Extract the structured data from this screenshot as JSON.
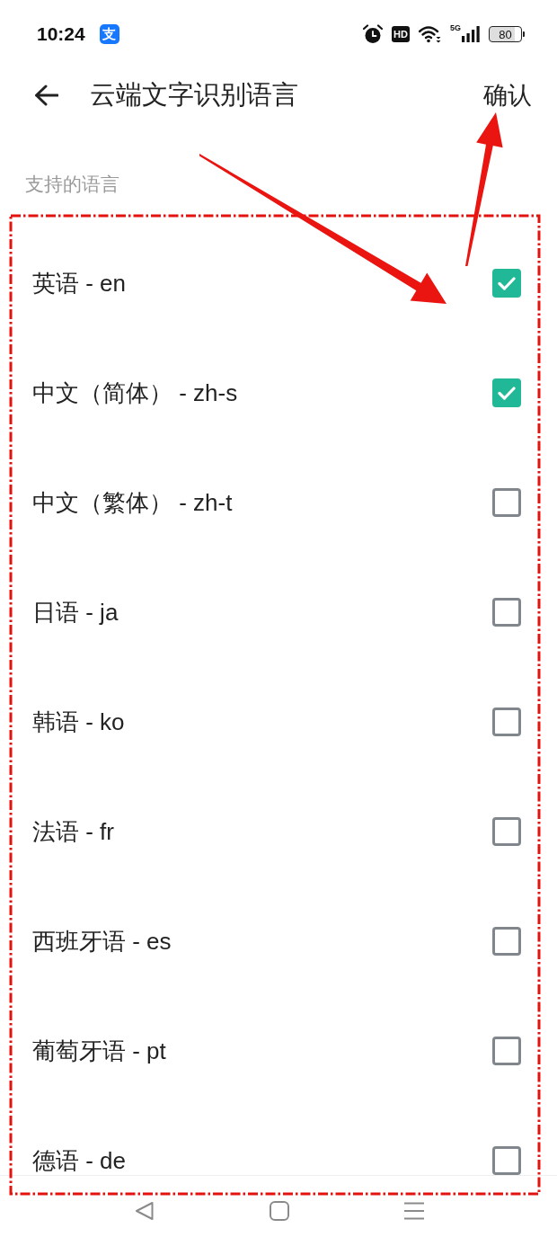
{
  "status_bar": {
    "time": "10:24",
    "app_icon_text": "支",
    "hd_badge": "HD",
    "network_type": "5G",
    "battery": "80"
  },
  "header": {
    "title": "云端文字识别语言",
    "confirm_button": "确认"
  },
  "section_label": "支持的语言",
  "languages": [
    {
      "label": "英语 - en",
      "checked": true
    },
    {
      "label": "中文（简体） - zh-s",
      "checked": true
    },
    {
      "label": "中文（繁体） - zh-t",
      "checked": false
    },
    {
      "label": "日语 - ja",
      "checked": false
    },
    {
      "label": "韩语 - ko",
      "checked": false
    },
    {
      "label": "法语 - fr",
      "checked": false
    },
    {
      "label": "西班牙语 - es",
      "checked": false
    },
    {
      "label": "葡萄牙语 - pt",
      "checked": false
    },
    {
      "label": "德语 - de",
      "checked": false
    }
  ]
}
